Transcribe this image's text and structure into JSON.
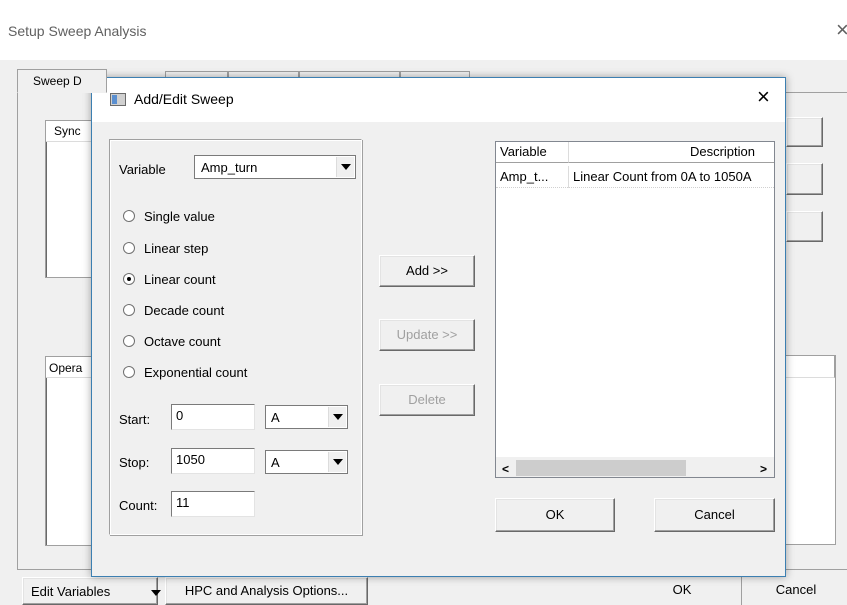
{
  "outer": {
    "title": "Setup Sweep Analysis",
    "close_glyph": "×",
    "tabs": [
      {
        "label": "Sweep D"
      },
      {
        "label": ""
      },
      {
        "label": ""
      },
      {
        "label": ""
      },
      {
        "label": ""
      }
    ],
    "group1_label": "Sync",
    "group2_label": "Opera",
    "bottom": {
      "edit_variables": "Edit Variables",
      "hpc_options": "HPC and Analysis Options...",
      "ok": "OK",
      "cancel": "Cancel"
    }
  },
  "dialog": {
    "title": "Add/Edit Sweep",
    "close_glyph": "×",
    "variable_label": "Variable",
    "variable_value": "Amp_turn",
    "options": [
      {
        "label": "Single value",
        "checked": false
      },
      {
        "label": "Linear step",
        "checked": false
      },
      {
        "label": "Linear count",
        "checked": true
      },
      {
        "label": "Decade count",
        "checked": false
      },
      {
        "label": "Octave count",
        "checked": false
      },
      {
        "label": "Exponential count",
        "checked": false
      }
    ],
    "start": {
      "label": "Start:",
      "value": "0",
      "unit": "A"
    },
    "stop": {
      "label": "Stop:",
      "value": "1050",
      "unit": "A"
    },
    "count": {
      "label": "Count:",
      "value": "11"
    },
    "buttons": {
      "add": "Add >>",
      "update": "Update >>",
      "delete": "Delete"
    },
    "table": {
      "columns": [
        "Variable",
        "Description"
      ],
      "rows": [
        {
          "variable": "Amp_t...",
          "description": "Linear Count from 0A to 1050A"
        }
      ]
    },
    "ok": "OK",
    "cancel": "Cancel"
  }
}
